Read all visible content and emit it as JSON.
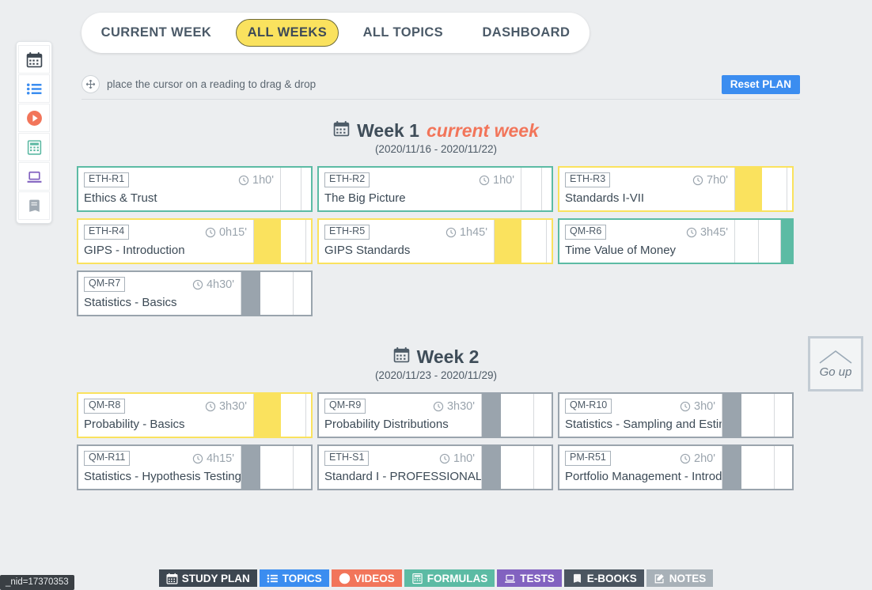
{
  "sidebar": {
    "items": [
      {
        "name": "calendar-icon",
        "icon": "calendar",
        "color": "#3d4751"
      },
      {
        "name": "topics-icon",
        "icon": "list",
        "color": "#3b8df0"
      },
      {
        "name": "videos-icon",
        "icon": "play",
        "color": "#f2755a"
      },
      {
        "name": "formulas-icon",
        "icon": "calculator",
        "color": "#5cb9a3"
      },
      {
        "name": "tests-icon",
        "icon": "laptop",
        "color": "#8262c0"
      },
      {
        "name": "ebooks-icon",
        "icon": "book",
        "color": "#98a3ad"
      }
    ]
  },
  "topnav": {
    "tabs": [
      {
        "label": "CURRENT WEEK",
        "active": false
      },
      {
        "label": "ALL WEEKS",
        "active": true
      },
      {
        "label": "ALL TOPICS",
        "active": false
      },
      {
        "label": "DASHBOARD",
        "active": false
      }
    ]
  },
  "hintbar": {
    "drag_icon": "move-icon",
    "text": "place the cursor on a reading to drag & drop",
    "reset_label": "Reset PLAN",
    "reset_color": "#3b8df0"
  },
  "colors": {
    "teal": "#5cbba4",
    "yellow": "#fae25e",
    "gray": "#9aa4ad",
    "accent_current": "#f2755a"
  },
  "weeks": [
    {
      "icon": "calendar-icon",
      "title": "Week 1",
      "current_label": "current week",
      "range": "(2020/11/16 - 2020/11/22)",
      "cards": [
        {
          "code": "ETH-R1",
          "duration": "1h0'",
          "title": "Ethics & Trust",
          "color": "#5cbba4",
          "body_w": 256,
          "segments": [
            26,
            24,
            0
          ],
          "fill_index": 2,
          "fill_w": 36
        },
        {
          "code": "ETH-R2",
          "duration": "1h0'",
          "title": "The Big Picture",
          "color": "#5cbba4",
          "body_w": 256,
          "segments": [
            26,
            24,
            0
          ],
          "fill_index": 2,
          "fill_w": 36
        },
        {
          "code": "ETH-R3",
          "duration": "7h0'",
          "title": "Standards I-VII",
          "color": "#fae25e",
          "body_w": 222,
          "segments": [
            0,
            32,
            32
          ],
          "fill_index": 1,
          "fill_w": 34
        },
        {
          "code": "ETH-R4",
          "duration": "0h15'",
          "title": "GIPS - Introduction",
          "color": "#fae25e",
          "body_w": 222,
          "segments": [
            0,
            32,
            32
          ],
          "fill_index": 1,
          "fill_w": 34
        },
        {
          "code": "ETH-R5",
          "duration": "1h45'",
          "title": "GIPS Standards",
          "color": "#fae25e",
          "body_w": 222,
          "segments": [
            0,
            32,
            32
          ],
          "fill_index": 1,
          "fill_w": 34
        },
        {
          "code": "QM-R6",
          "duration": "3h45'",
          "title": "Time Value of Money",
          "color": "#5cbba4",
          "body_w": 222,
          "segments": [
            30,
            28,
            0
          ],
          "fill_index": 2,
          "fill_w": 34
        },
        {
          "code": "QM-R7",
          "duration": "4h30'",
          "title": "Statistics - Basics",
          "color": "#9aa4ad",
          "body_w": 206,
          "segments": [
            0,
            42,
            34
          ],
          "fill_index": 1,
          "fill_w": 24
        }
      ]
    },
    {
      "icon": "calendar-icon",
      "title": "Week 2",
      "current_label": "",
      "range": "(2020/11/23 - 2020/11/29)",
      "cards": [
        {
          "code": "QM-R8",
          "duration": "3h30'",
          "title": "Probability - Basics",
          "color": "#fae25e",
          "body_w": 222,
          "segments": [
            0,
            32,
            32
          ],
          "fill_index": 1,
          "fill_w": 34
        },
        {
          "code": "QM-R9",
          "duration": "3h30'",
          "title": "Probability Distributions",
          "color": "#9aa4ad",
          "body_w": 206,
          "segments": [
            0,
            42,
            34
          ],
          "fill_index": 1,
          "fill_w": 24
        },
        {
          "code": "QM-R10",
          "duration": "3h0'",
          "title": "Statistics - Sampling and Estimation",
          "color": "#9aa4ad",
          "body_w": 206,
          "segments": [
            0,
            42,
            34
          ],
          "fill_index": 1,
          "fill_w": 24
        },
        {
          "code": "QM-R11",
          "duration": "4h15'",
          "title": "Statistics - Hypothesis Testing",
          "color": "#9aa4ad",
          "body_w": 206,
          "segments": [
            0,
            42,
            34
          ],
          "fill_index": 1,
          "fill_w": 24
        },
        {
          "code": "ETH-S1",
          "duration": "1h0'",
          "title": "Standard I - PROFESSIONALISM",
          "color": "#9aa4ad",
          "body_w": 206,
          "segments": [
            0,
            42,
            34
          ],
          "fill_index": 1,
          "fill_w": 24
        },
        {
          "code": "PM-R51",
          "duration": "2h0'",
          "title": "Portfolio Management - Introduction",
          "color": "#9aa4ad",
          "body_w": 206,
          "segments": [
            0,
            42,
            34
          ],
          "fill_index": 1,
          "fill_w": 24
        }
      ]
    }
  ],
  "goup": {
    "label": "Go up",
    "icon": "chevron-up-icon"
  },
  "bottombar": {
    "buttons": [
      {
        "label": "STUDY PLAN",
        "icon": "calendar",
        "bg": "#3d4751"
      },
      {
        "label": "TOPICS",
        "icon": "list",
        "bg": "#3b8df0"
      },
      {
        "label": "VIDEOS",
        "icon": "play",
        "bg": "#f2755a"
      },
      {
        "label": "FORMULAS",
        "icon": "calculator",
        "bg": "#5cbba4"
      },
      {
        "label": "TESTS",
        "icon": "laptop",
        "bg": "#8262c0"
      },
      {
        "label": "E-BOOKS",
        "icon": "book",
        "bg": "#4b5560"
      },
      {
        "label": "NOTES",
        "icon": "notes",
        "bg": "#a8b1b8"
      }
    ]
  },
  "status": {
    "text": "_nid=17370353"
  }
}
